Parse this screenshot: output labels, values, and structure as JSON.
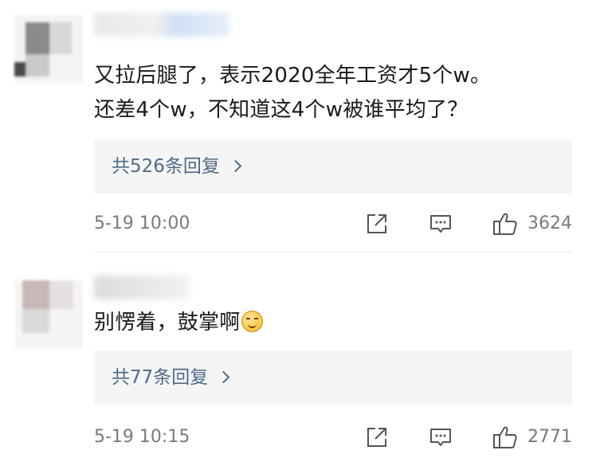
{
  "comments": [
    {
      "text_line1": "又拉后腿了，表示2020全年工资才5个w。",
      "text_line2": "还差4个w，不知道这4个w被谁平均了？",
      "replies_label": "共526条回复",
      "timestamp": "5-19 10:00",
      "likes": "3624"
    },
    {
      "text_line1": "别愣着，鼓掌啊",
      "emoji": "smirk-face-emoji",
      "replies_label": "共77条回复",
      "timestamp": "5-19 10:15",
      "likes": "2771"
    }
  ],
  "icons": {
    "share": "share-icon",
    "reply": "comment-icon",
    "like": "thumbs-up-icon",
    "chevron": "chevron-right-icon"
  },
  "colors": {
    "link": "#4f6b8c",
    "meta": "#7a7a7a",
    "reply_bg": "#f5f5f5"
  }
}
